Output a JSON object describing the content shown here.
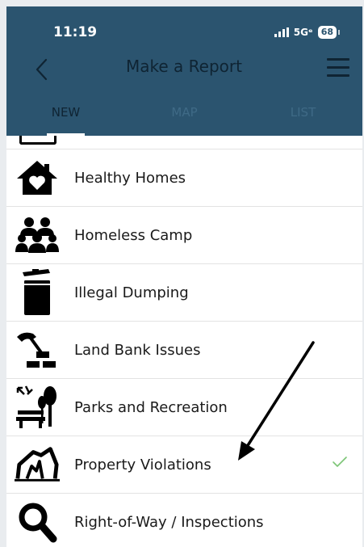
{
  "status_bar": {
    "time": "11:19",
    "network": "5Gᵉ",
    "battery": "68"
  },
  "header": {
    "title": "Make a Report",
    "back_icon": "chevron-left-icon",
    "menu_icon": "hamburger-menu-icon",
    "background_color": "#2b546f"
  },
  "tabs": [
    {
      "label": "NEW",
      "active": true
    },
    {
      "label": "MAP",
      "active": false
    },
    {
      "label": "LIST",
      "active": false
    }
  ],
  "list": {
    "items": [
      {
        "label": "Healthy Homes",
        "icon": "house-heart-icon"
      },
      {
        "label": "Homeless Camp",
        "icon": "people-group-icon"
      },
      {
        "label": "Illegal Dumping",
        "icon": "trash-can-icon"
      },
      {
        "label": "Land Bank Issues",
        "icon": "hammer-bricks-icon"
      },
      {
        "label": "Parks and Recreation",
        "icon": "park-bench-tree-icon"
      },
      {
        "label": "Property Violations",
        "icon": "collapsed-house-icon",
        "checked": true
      },
      {
        "label": "Right-of-Way / Inspections",
        "icon": "magnifier-icon"
      }
    ],
    "check_color": "#7cc576"
  }
}
